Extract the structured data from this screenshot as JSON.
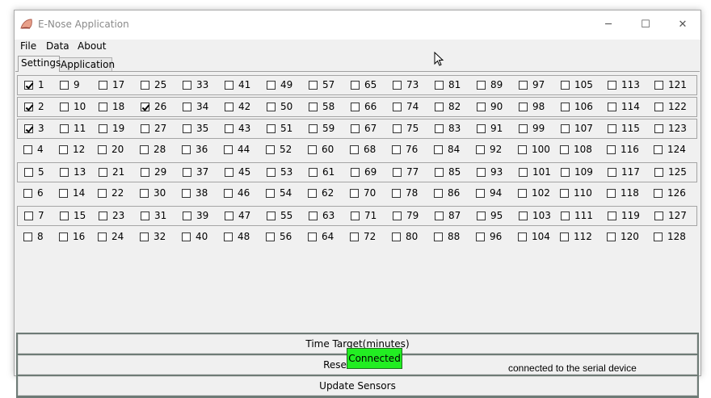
{
  "window": {
    "title": "E-Nose Application",
    "controls": {
      "minimize": "─",
      "maximize": "☐",
      "close": "✕"
    }
  },
  "menu": [
    "File",
    "Data",
    "About"
  ],
  "tabs": {
    "settings": "Settings",
    "application": "Application"
  },
  "sensors": [
    {
      "label": "1",
      "checked": true
    },
    {
      "label": "9",
      "checked": false
    },
    {
      "label": "17",
      "checked": false
    },
    {
      "label": "25",
      "checked": false
    },
    {
      "label": "33",
      "checked": false
    },
    {
      "label": "41",
      "checked": false
    },
    {
      "label": "49",
      "checked": false
    },
    {
      "label": "57",
      "checked": false
    },
    {
      "label": "65",
      "checked": false
    },
    {
      "label": "73",
      "checked": false
    },
    {
      "label": "81",
      "checked": false
    },
    {
      "label": "89",
      "checked": false
    },
    {
      "label": "97",
      "checked": false
    },
    {
      "label": "105",
      "checked": false
    },
    {
      "label": "113",
      "checked": false
    },
    {
      "label": "121",
      "checked": false
    },
    {
      "label": "2",
      "checked": true
    },
    {
      "label": "10",
      "checked": false
    },
    {
      "label": "18",
      "checked": false
    },
    {
      "label": "26",
      "checked": true
    },
    {
      "label": "34",
      "checked": false
    },
    {
      "label": "42",
      "checked": false
    },
    {
      "label": "50",
      "checked": false
    },
    {
      "label": "58",
      "checked": false
    },
    {
      "label": "66",
      "checked": false
    },
    {
      "label": "74",
      "checked": false
    },
    {
      "label": "82",
      "checked": false
    },
    {
      "label": "90",
      "checked": false
    },
    {
      "label": "98",
      "checked": false
    },
    {
      "label": "106",
      "checked": false
    },
    {
      "label": "114",
      "checked": false
    },
    {
      "label": "122",
      "checked": false
    },
    {
      "label": "3",
      "checked": true
    },
    {
      "label": "11",
      "checked": false
    },
    {
      "label": "19",
      "checked": false
    },
    {
      "label": "27",
      "checked": false
    },
    {
      "label": "35",
      "checked": false
    },
    {
      "label": "43",
      "checked": false
    },
    {
      "label": "51",
      "checked": false
    },
    {
      "label": "59",
      "checked": false
    },
    {
      "label": "67",
      "checked": false
    },
    {
      "label": "75",
      "checked": false
    },
    {
      "label": "83",
      "checked": false
    },
    {
      "label": "91",
      "checked": false
    },
    {
      "label": "99",
      "checked": false
    },
    {
      "label": "107",
      "checked": false
    },
    {
      "label": "115",
      "checked": false
    },
    {
      "label": "123",
      "checked": false
    },
    {
      "label": "4",
      "checked": false
    },
    {
      "label": "12",
      "checked": false
    },
    {
      "label": "20",
      "checked": false
    },
    {
      "label": "28",
      "checked": false
    },
    {
      "label": "36",
      "checked": false
    },
    {
      "label": "44",
      "checked": false
    },
    {
      "label": "52",
      "checked": false
    },
    {
      "label": "60",
      "checked": false
    },
    {
      "label": "68",
      "checked": false
    },
    {
      "label": "76",
      "checked": false
    },
    {
      "label": "84",
      "checked": false
    },
    {
      "label": "92",
      "checked": false
    },
    {
      "label": "100",
      "checked": false
    },
    {
      "label": "108",
      "checked": false
    },
    {
      "label": "116",
      "checked": false
    },
    {
      "label": "124",
      "checked": false
    },
    {
      "label": "5",
      "checked": false
    },
    {
      "label": "13",
      "checked": false
    },
    {
      "label": "21",
      "checked": false
    },
    {
      "label": "29",
      "checked": false
    },
    {
      "label": "37",
      "checked": false
    },
    {
      "label": "45",
      "checked": false
    },
    {
      "label": "53",
      "checked": false
    },
    {
      "label": "61",
      "checked": false
    },
    {
      "label": "69",
      "checked": false
    },
    {
      "label": "77",
      "checked": false
    },
    {
      "label": "85",
      "checked": false
    },
    {
      "label": "93",
      "checked": false
    },
    {
      "label": "101",
      "checked": false
    },
    {
      "label": "109",
      "checked": false
    },
    {
      "label": "117",
      "checked": false
    },
    {
      "label": "125",
      "checked": false
    },
    {
      "label": "6",
      "checked": false
    },
    {
      "label": "14",
      "checked": false
    },
    {
      "label": "22",
      "checked": false
    },
    {
      "label": "30",
      "checked": false
    },
    {
      "label": "38",
      "checked": false
    },
    {
      "label": "46",
      "checked": false
    },
    {
      "label": "54",
      "checked": false
    },
    {
      "label": "62",
      "checked": false
    },
    {
      "label": "70",
      "checked": false
    },
    {
      "label": "78",
      "checked": false
    },
    {
      "label": "86",
      "checked": false
    },
    {
      "label": "94",
      "checked": false
    },
    {
      "label": "102",
      "checked": false
    },
    {
      "label": "110",
      "checked": false
    },
    {
      "label": "118",
      "checked": false
    },
    {
      "label": "126",
      "checked": false
    },
    {
      "label": "7",
      "checked": false
    },
    {
      "label": "15",
      "checked": false
    },
    {
      "label": "23",
      "checked": false
    },
    {
      "label": "31",
      "checked": false
    },
    {
      "label": "39",
      "checked": false
    },
    {
      "label": "47",
      "checked": false
    },
    {
      "label": "55",
      "checked": false
    },
    {
      "label": "63",
      "checked": false
    },
    {
      "label": "71",
      "checked": false
    },
    {
      "label": "79",
      "checked": false
    },
    {
      "label": "87",
      "checked": false
    },
    {
      "label": "95",
      "checked": false
    },
    {
      "label": "103",
      "checked": false
    },
    {
      "label": "111",
      "checked": false
    },
    {
      "label": "119",
      "checked": false
    },
    {
      "label": "127",
      "checked": false
    },
    {
      "label": "8",
      "checked": false
    },
    {
      "label": "16",
      "checked": false
    },
    {
      "label": "24",
      "checked": false
    },
    {
      "label": "32",
      "checked": false
    },
    {
      "label": "40",
      "checked": false
    },
    {
      "label": "48",
      "checked": false
    },
    {
      "label": "56",
      "checked": false
    },
    {
      "label": "64",
      "checked": false
    },
    {
      "label": "72",
      "checked": false
    },
    {
      "label": "80",
      "checked": false
    },
    {
      "label": "88",
      "checked": false
    },
    {
      "label": "96",
      "checked": false
    },
    {
      "label": "104",
      "checked": false
    },
    {
      "label": "112",
      "checked": false
    },
    {
      "label": "120",
      "checked": false
    },
    {
      "label": "128",
      "checked": false
    }
  ],
  "actions": {
    "time_target": "Time Target(minutes)",
    "reset_sensors": "Reset Sensors",
    "update_sensors": "Update Sensors"
  },
  "status": {
    "button_label": "Connected",
    "button_color": "#22ee22",
    "message": "connected to the serial device"
  },
  "icons": {
    "app": "nose-icon",
    "cursor": "mouse-pointer-icon"
  }
}
